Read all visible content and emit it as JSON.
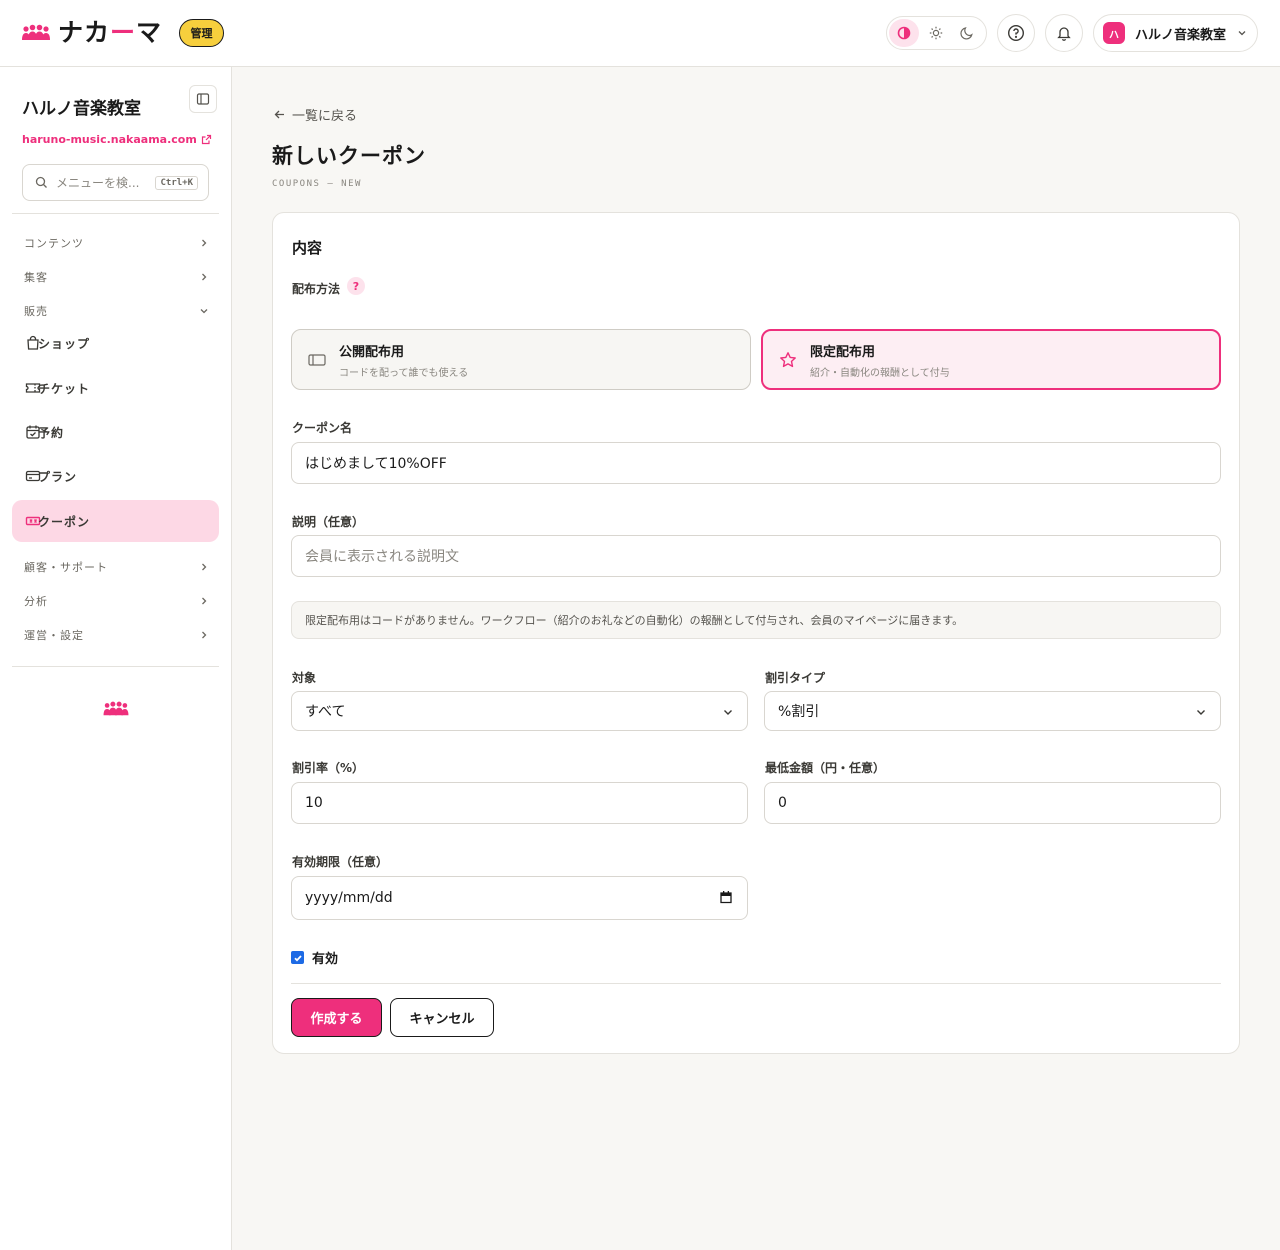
{
  "header": {
    "brand": {
      "name_pre": "ナカ",
      "name_accent": "ー",
      "name_post": "マ",
      "badge": "管理",
      "logo_icon": "people-group-icon"
    },
    "theme": {
      "options": [
        "contrast-icon",
        "sun-icon",
        "moon-icon"
      ],
      "active": "contrast-icon"
    },
    "account": {
      "avatar_text": "ハ",
      "name": "ハルノ音楽教室"
    }
  },
  "sidebar": {
    "org_name": "ハルノ音楽教室",
    "org_url": "haruno-music.nakaama.com",
    "search_placeholder": "メニューを検...",
    "search_shortcut": "Ctrl+K",
    "sections": {
      "content": "コンテンツ",
      "marketing": "集客",
      "sales": "販売",
      "customers": "顧客・サポート",
      "analytics": "分析",
      "operations": "運営・設定"
    },
    "items": {
      "shop": "ショップ",
      "ticket": "チケット",
      "booking": "予約",
      "plan": "プラン",
      "coupon": "クーポン"
    }
  },
  "main": {
    "back": "一覧に戻る",
    "title": "新しいクーポン",
    "subtitle": "COUPONS — NEW",
    "card": {
      "title": "内容",
      "distribution_label": "配布方法",
      "help": "?",
      "public_title": "公開配布用",
      "public_desc": "コードを配って誰でも使える",
      "limited_title": "限定配布用",
      "limited_desc": "紹介・自動化の報酬として付与",
      "selected": "limited",
      "name_label": "クーポン名",
      "name_value": "はじめまして10%OFF",
      "desc_label": "説明（任意）",
      "desc_placeholder": "会員に表示される説明文",
      "notice": "限定配布用はコードがありません。ワークフロー（紹介のお礼などの自動化）の報酬として付与され、会員のマイページに届きます。",
      "target_label": "対象",
      "target_value": "すべて",
      "type_label": "割引タイプ",
      "type_value": "%割引",
      "rate_label": "割引率（%）",
      "rate_value": "10",
      "min_label": "最低金額（円・任意）",
      "min_value": "0",
      "expiry_label": "有効期限（任意）",
      "expiry_placeholder": "yyyy/mm/dd",
      "active_label": "有効",
      "active_checked": true,
      "create_button": "作成する",
      "cancel_button": "キャンセル"
    }
  },
  "colors": {
    "accent": "#ee2f7c",
    "badge": "#f7cf3d",
    "active_nav": "#fdd8e5",
    "checkbox": "#1d6ae5"
  }
}
